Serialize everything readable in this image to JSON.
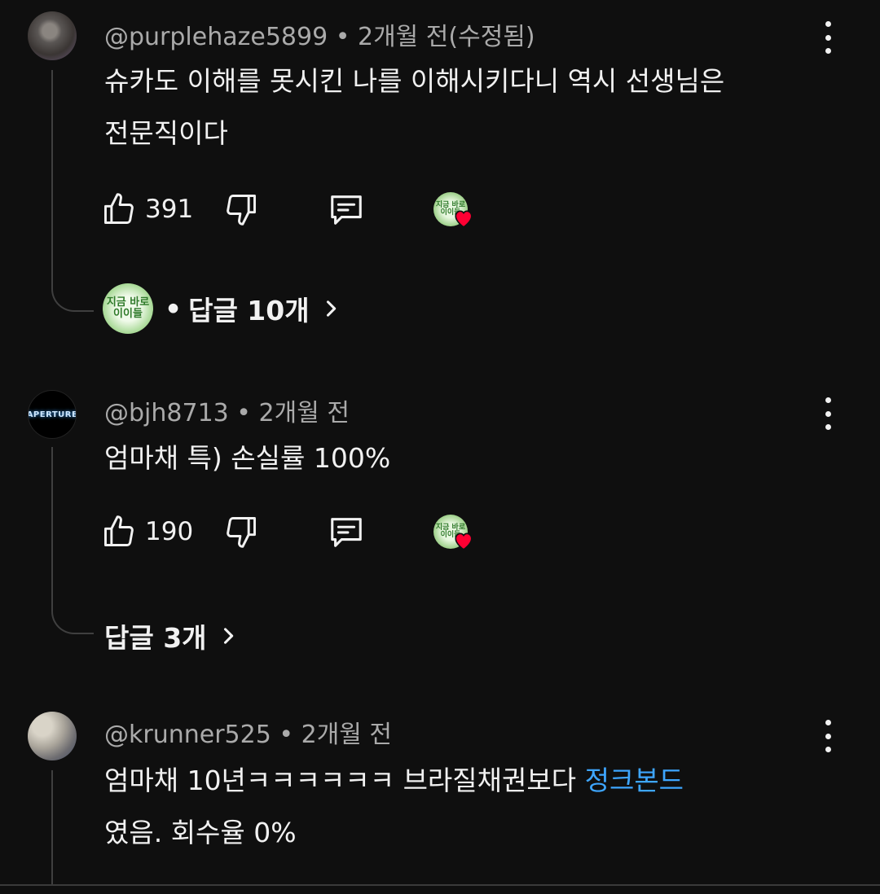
{
  "comments": [
    {
      "handle": "@purplehaze5899",
      "time": "2개월 전(수정됨)",
      "text_line1": "슈카도 이해를 못시킨 나를 이해시키다니 역시 선생님은",
      "text_line2": "전문직이다",
      "likes": "391",
      "replies_label": "답글 10개",
      "replies_prefix": "•",
      "replies_avatar_text": "지금 바로 이이들"
    },
    {
      "handle": "@bjh8713",
      "avatar_text": "APERTURE",
      "time": "2개월 전",
      "text_line1": "엄마채 특) 손실률 100%",
      "likes": "190",
      "replies_label": "답글 3개"
    },
    {
      "handle": "@krunner525",
      "time": "2개월 전",
      "text_line1_plain": "엄마채 10년ㅋㅋㅋㅋㅋㅋ 브라질채권보다 ",
      "text_line1_link": "정크본드",
      "text_line2": "였음. 회수율 0%"
    }
  ],
  "creator_heart_avatar_text": "지금 바로 이이들",
  "separator": "•",
  "icons": {
    "like": "thumbs-up-icon",
    "dislike": "thumbs-down-icon",
    "reply": "reply-comment-icon",
    "heart": "heart-icon",
    "more": "more-vertical-icon",
    "chevron": "chevron-right-icon"
  },
  "colors": {
    "background": "#0f0f0f",
    "text": "#f1f1f1",
    "meta": "#aaaaaa",
    "link": "#3ea6ff",
    "heart": "#ff0033"
  }
}
